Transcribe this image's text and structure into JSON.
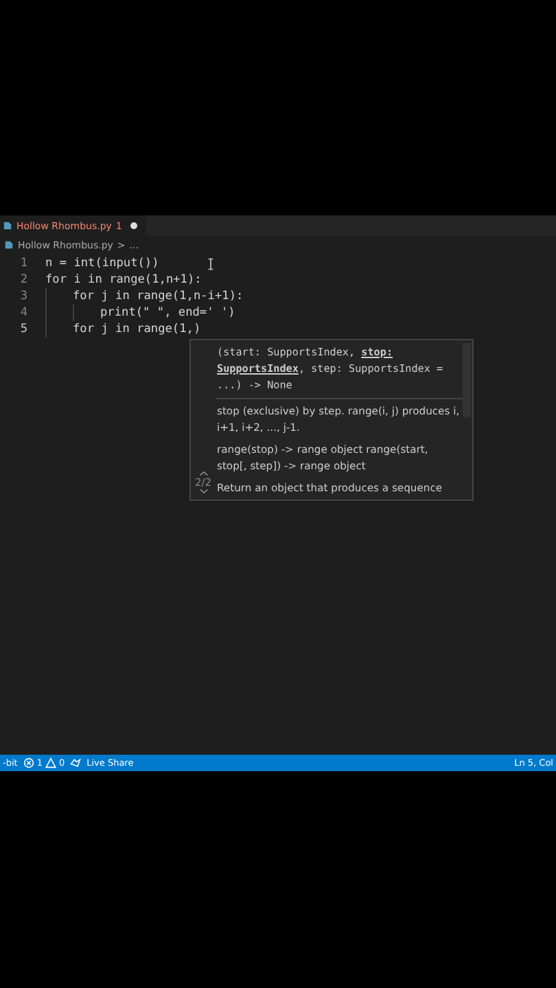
{
  "tab": {
    "title": "Hollow Rhombus.py",
    "problems": "1",
    "modified": true
  },
  "breadcrumb": {
    "file": "Hollow Rhombus.py",
    "separator": ">",
    "rest": "..."
  },
  "code_lines": [
    {
      "number": "1",
      "text": "n = int(input())",
      "current": false
    },
    {
      "number": "2",
      "text": "for i in range(1,n+1):",
      "current": false,
      "children": [
        {
          "number": "3",
          "text": "for j in range(1,n-i+1):",
          "current": false,
          "children": [
            {
              "number": "4",
              "text": "print(\" \", end=' ')",
              "current": false
            }
          ]
        },
        {
          "number": "5",
          "text": "for j in range(1,)",
          "current": true
        }
      ]
    }
  ],
  "hover": {
    "signature": "(start: SupportsIndex, **stop: SupportsIndex**, step: SupportsIndex = ...) -> None",
    "paragraphs": [
      "stop (exclusive) by step.  range(i, j) produces i, i+1, i+2, ..., j-1.",
      "range(stop) -> range object range(start, stop[, step]) -> range object",
      "Return an object that produces a sequence"
    ],
    "counter": "2/2"
  },
  "status_bar": {
    "left": "-bit",
    "errors": "1",
    "warnings": "0",
    "live_share": "Live Share",
    "position": "Ln 5, Col"
  }
}
